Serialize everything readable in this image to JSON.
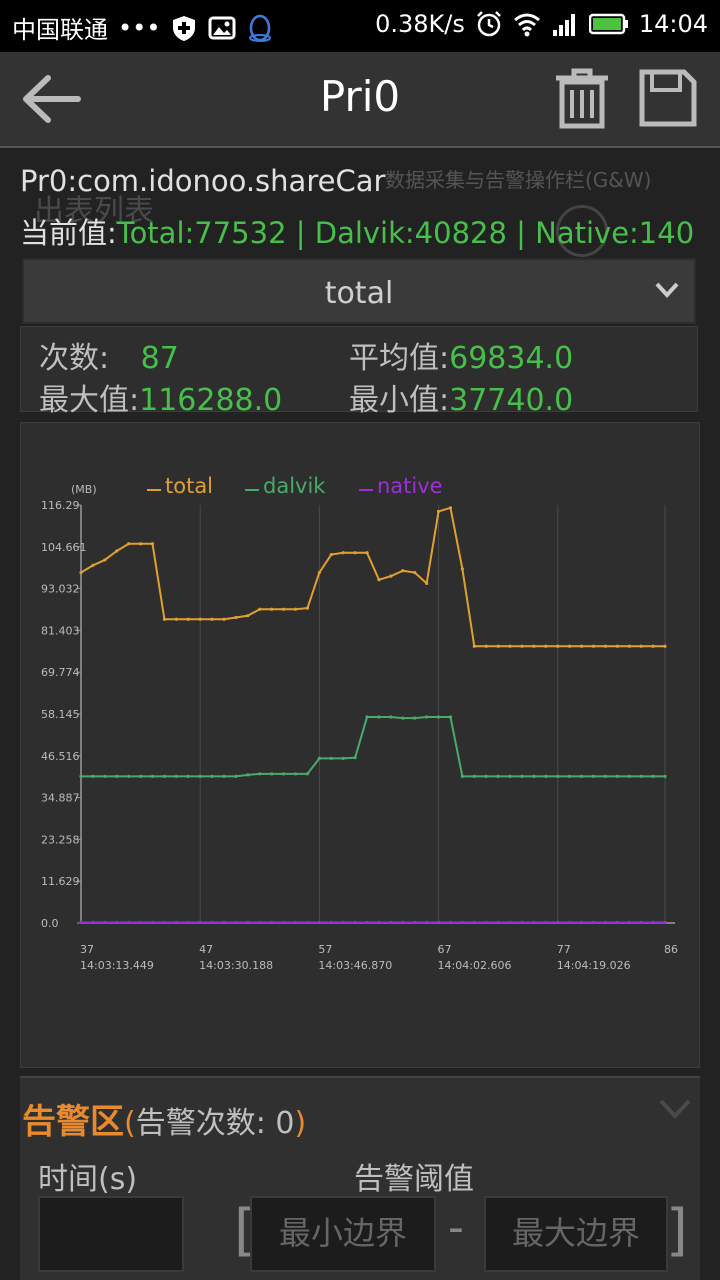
{
  "status_bar": {
    "carrier": "中国联通",
    "dots": "•••",
    "net_speed": "0.38K/s",
    "time": "14:04"
  },
  "action_bar": {
    "title": "Pri0",
    "icons": [
      "back-arrow-icon",
      "trash-icon",
      "save-icon"
    ]
  },
  "info": {
    "package": "Pr0:com.idonoo.shareCar",
    "current_label": "当前值:",
    "current_value": "Total:77532 | Dalvik:40828 | Native:140",
    "ghost_caption": "数据采集与告警操作栏(G&W)",
    "ghost_list": "出表列表"
  },
  "dropdown": {
    "selected": "total"
  },
  "stats": {
    "count_label": "次数:",
    "count_value": "87",
    "avg_label": "平均值:",
    "avg_value": "69834.0",
    "max_label": "最大值:",
    "max_value": "116288.0",
    "min_label": "最小值:",
    "min_value": "37740.0"
  },
  "colors": {
    "total": "#e0a030",
    "dalvik": "#4aaa6a",
    "native": "#9b30d8",
    "accent_green": "#46c04a",
    "alarm_orange": "#e98a2e"
  },
  "chart_data": {
    "type": "line",
    "ylabel": "(MB)",
    "ylim": [
      0,
      116.29
    ],
    "yticks": [
      "0.0",
      "11.629",
      "23.258",
      "34.887",
      "46.516",
      "58.145",
      "69.774",
      "81.403",
      "93.032",
      "104.661",
      "116.29"
    ],
    "xlim": [
      37,
      86
    ],
    "xticks": [
      {
        "value": 37,
        "label": "37",
        "time": "14:03:13.449"
      },
      {
        "value": 47,
        "label": "47",
        "time": "14:03:30.188"
      },
      {
        "value": 57,
        "label": "57",
        "time": "14:03:46.870"
      },
      {
        "value": 67,
        "label": "67",
        "time": "14:04:02.606"
      },
      {
        "value": 77,
        "label": "77",
        "time": "14:04:19.026"
      },
      {
        "value": 86,
        "label": "86",
        "time": ""
      }
    ],
    "x": [
      37,
      38,
      39,
      40,
      41,
      42,
      43,
      44,
      45,
      46,
      47,
      48,
      49,
      50,
      51,
      52,
      53,
      54,
      55,
      56,
      57,
      58,
      59,
      60,
      61,
      62,
      63,
      64,
      65,
      66,
      67,
      68,
      69,
      70,
      71,
      72,
      73,
      74,
      75,
      76,
      77,
      78,
      79,
      80,
      81,
      82,
      83,
      84,
      85,
      86
    ],
    "series": [
      {
        "name": "total",
        "values": [
          97.5,
          99.5,
          101.0,
          103.5,
          105.5,
          105.5,
          105.5,
          84.5,
          84.5,
          84.5,
          84.5,
          84.5,
          84.5,
          85.0,
          85.5,
          87.3,
          87.3,
          87.3,
          87.3,
          87.6,
          97.5,
          102.5,
          103.0,
          103.0,
          103.0,
          95.5,
          96.5,
          98.0,
          97.5,
          94.5,
          114.5,
          115.5,
          98.5,
          77.0,
          77.0,
          77.0,
          77.0,
          77.0,
          77.0,
          77.0,
          77.0,
          77.0,
          77.0,
          77.0,
          77.0,
          77.0,
          77.0,
          77.0,
          77.0,
          77.0
        ]
      },
      {
        "name": "dalvik",
        "values": [
          40.8,
          40.8,
          40.8,
          40.8,
          40.8,
          40.8,
          40.8,
          40.8,
          40.8,
          40.8,
          40.8,
          40.8,
          40.8,
          40.8,
          41.2,
          41.5,
          41.5,
          41.5,
          41.5,
          41.5,
          45.8,
          45.8,
          45.8,
          46.0,
          57.3,
          57.3,
          57.3,
          57.0,
          57.0,
          57.3,
          57.3,
          57.3,
          40.8,
          40.8,
          40.8,
          40.8,
          40.8,
          40.8,
          40.8,
          40.8,
          40.8,
          40.8,
          40.8,
          40.8,
          40.8,
          40.8,
          40.8,
          40.8,
          40.8,
          40.8
        ]
      },
      {
        "name": "native",
        "values": [
          0.14,
          0.14,
          0.14,
          0.14,
          0.14,
          0.14,
          0.14,
          0.14,
          0.14,
          0.14,
          0.14,
          0.14,
          0.14,
          0.14,
          0.14,
          0.14,
          0.14,
          0.14,
          0.14,
          0.14,
          0.14,
          0.14,
          0.14,
          0.14,
          0.14,
          0.14,
          0.14,
          0.14,
          0.14,
          0.14,
          0.14,
          0.14,
          0.14,
          0.14,
          0.14,
          0.14,
          0.14,
          0.14,
          0.14,
          0.14,
          0.14,
          0.14,
          0.14,
          0.14,
          0.14,
          0.14,
          0.14,
          0.14,
          0.14,
          0.14
        ]
      }
    ],
    "legend": [
      "total",
      "dalvik",
      "native"
    ],
    "legend_position": "top",
    "grid": true
  },
  "alarm": {
    "title": "告警区",
    "count_open": "(",
    "count_label": "告警次数: ",
    "count_value": "0",
    "count_close": ")",
    "time_label": "时间(s)",
    "threshold_label": "告警阈值",
    "min_placeholder": "最小边界",
    "max_placeholder": "最大边界",
    "bracket_open": "[",
    "dash": "-",
    "bracket_close": "]"
  }
}
